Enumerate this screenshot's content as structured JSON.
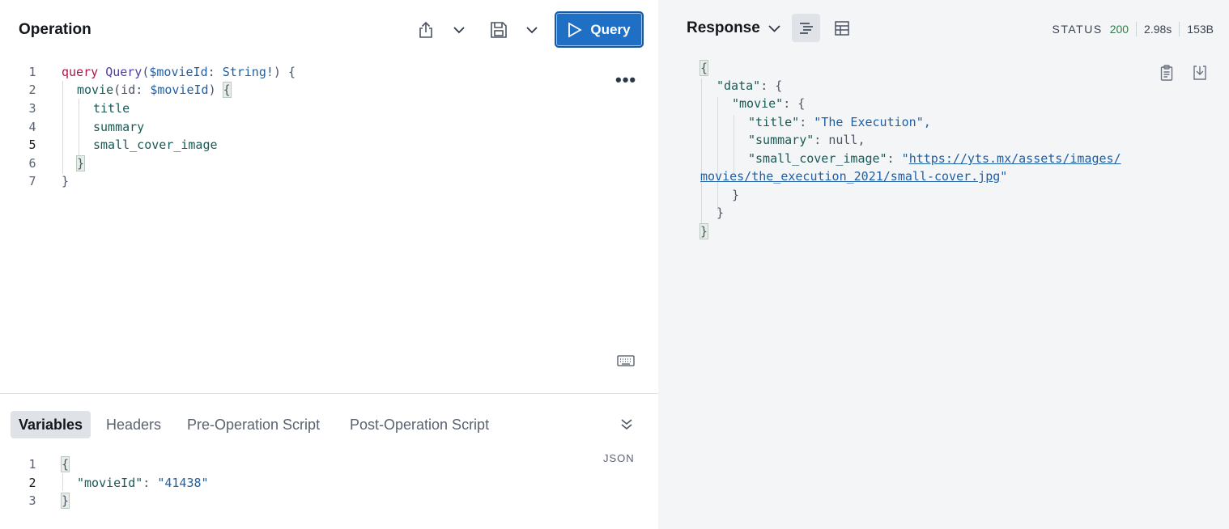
{
  "operation": {
    "title": "Operation",
    "run_label": "Query",
    "lines": [
      "1",
      "2",
      "3",
      "4",
      "5",
      "6",
      "7"
    ],
    "code": {
      "l1_kw": "query",
      "l1_name": "Query",
      "l1_open": "(",
      "l1_var": "$movieId",
      "l1_colon": ": ",
      "l1_type": "String!",
      "l1_close": ") {",
      "l2_field": "movie",
      "l2_open": "(id: ",
      "l2_var": "$movieId",
      "l2_close": ") ",
      "l2_brace": "{",
      "l3": "title",
      "l4": "summary",
      "l5": "small_cover_image",
      "l6": "}",
      "l7": "}"
    }
  },
  "tabs": [
    "Variables",
    "Headers",
    "Pre-Operation Script",
    "Post-Operation Script"
  ],
  "variables": {
    "format_label": "JSON",
    "lines": [
      "1",
      "2",
      "3"
    ],
    "l1": "{",
    "l2_key": "\"movieId\"",
    "l2_colon": ": ",
    "l2_val": "\"41438\"",
    "l3": "}"
  },
  "response": {
    "title": "Response",
    "status_label": "STATUS",
    "status_code": "200",
    "time": "2.98s",
    "size": "153B",
    "body": {
      "open": "{",
      "data_key": "\"data\"",
      "movie_key": "\"movie\"",
      "title_key": "\"title\"",
      "title_val": "\"The Execution\",",
      "summary_key": "\"summary\"",
      "summary_val": "null,",
      "cover_key": "\"small_cover_image\"",
      "cover_quote_open": "\"",
      "cover_url_1": "https://yts.mx/assets/images/",
      "cover_url_2": "movies/the_execution_2021/small-cover.jpg",
      "cover_quote_close": "\"",
      "colon_brace": ": {",
      "colon": ": ",
      "close_inner": "}",
      "close_mid": "}",
      "close": "}"
    }
  },
  "colors": {
    "accent": "#1f6fc5",
    "status_ok": "#2f7d4a",
    "keyword": "#b5114d"
  }
}
